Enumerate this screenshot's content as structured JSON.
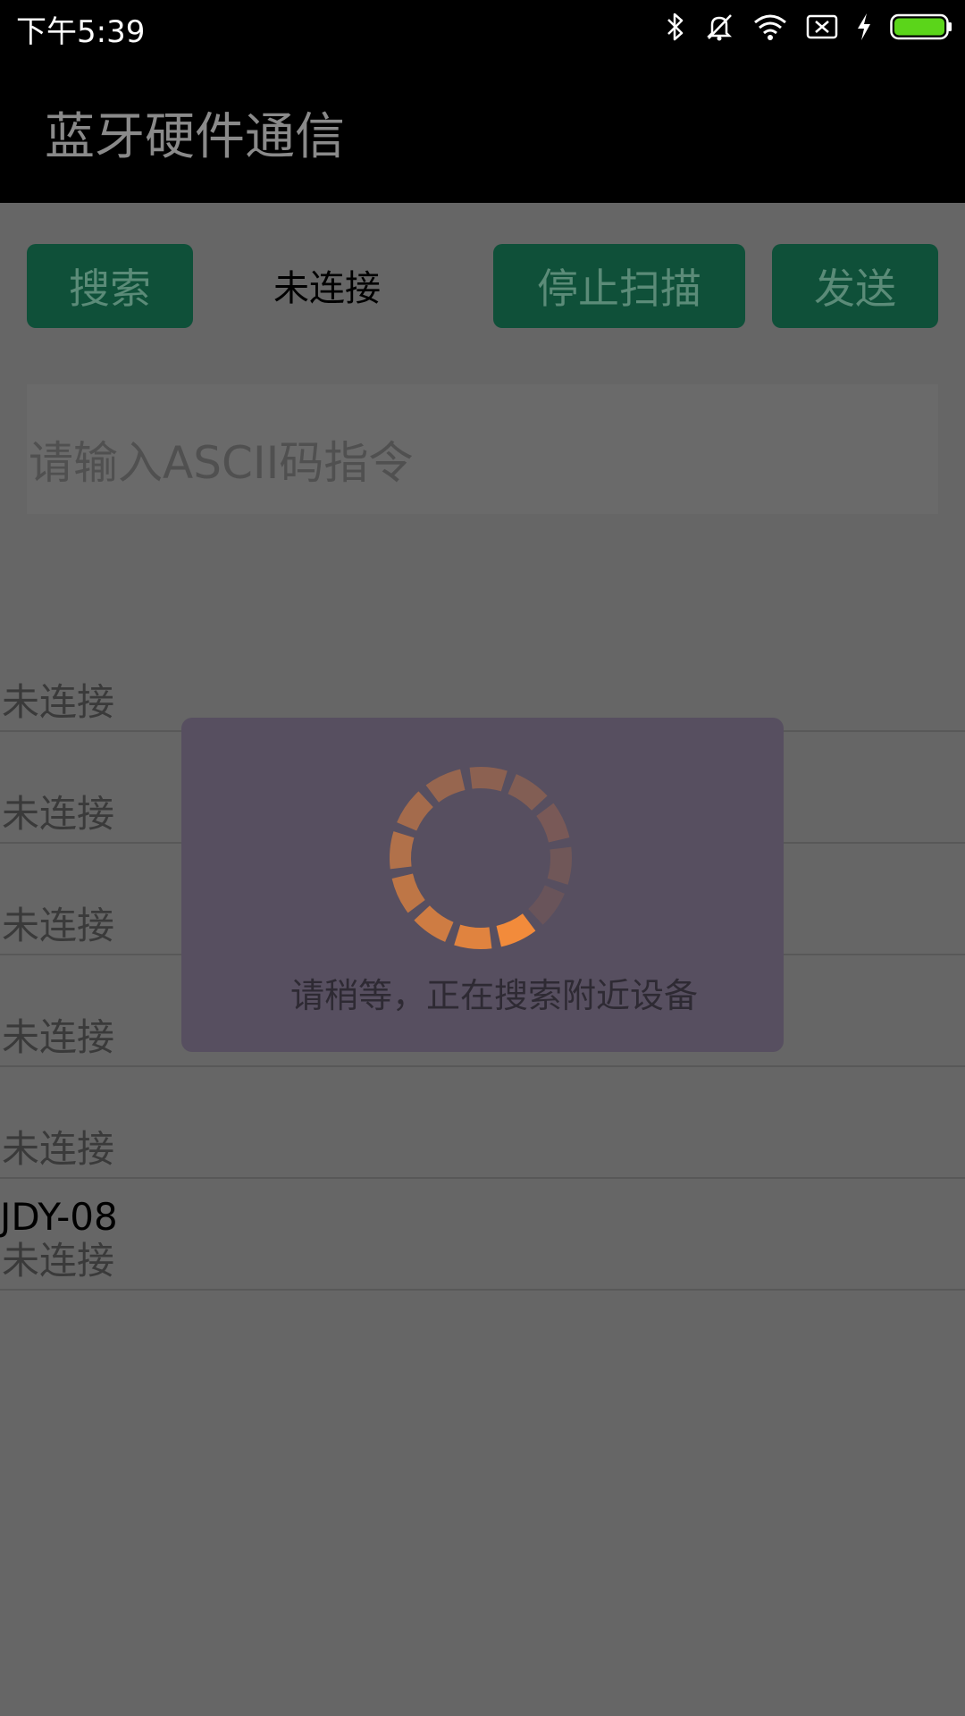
{
  "status_bar": {
    "time": "下午5:39",
    "icons": [
      "bluetooth-icon",
      "notifications-off-icon",
      "wifi-icon",
      "sim-missing-icon",
      "charging-icon",
      "battery-icon"
    ]
  },
  "app_bar": {
    "title": "蓝牙硬件通信"
  },
  "controls": {
    "search_label": "搜索",
    "connection_status": "未连接",
    "stop_scan_label": "停止扫描",
    "send_label": "发送"
  },
  "command_input": {
    "placeholder": "请输入ASCII码指令",
    "value": ""
  },
  "devices": [
    {
      "name": "",
      "status": "未连接"
    },
    {
      "name": "",
      "status": "未连接"
    },
    {
      "name": "",
      "status": "未连接"
    },
    {
      "name": "",
      "status": "未连接"
    },
    {
      "name": "",
      "status": "未连接"
    },
    {
      "name": "JDY-08",
      "status": "未连接"
    }
  ],
  "loading_dialog": {
    "message": "请稍等，正在搜索附近设备"
  },
  "colors": {
    "button_bg": "#0f5039",
    "overlay_bg": "#666666",
    "dialog_bg": "#574f60",
    "spinner_accent": "#f28b3b",
    "battery": "#5bd51a"
  }
}
